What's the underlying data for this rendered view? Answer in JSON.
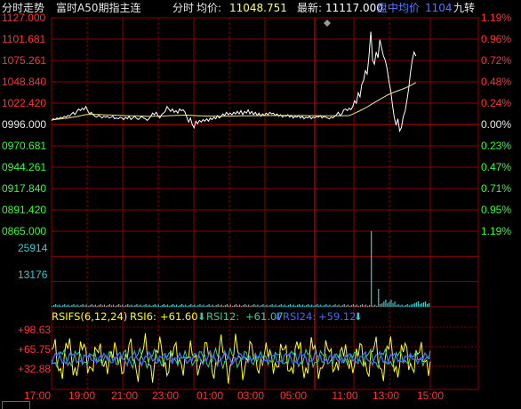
{
  "header": {
    "mode_label": "分时走势",
    "instrument": "富时A50期指主连",
    "series_label": "分时",
    "avg_label": "均价:",
    "avg_value": "11048.751",
    "last_label": "最新:",
    "last_value": "11117.000",
    "vwap_label": "盘中均价",
    "vwap_value": "1104",
    "right_label": "九转"
  },
  "indicator": {
    "name": "RSIFS(6,12,24)",
    "rsi6_label": "RSI6:",
    "rsi6_value": "+61.60",
    "rsi12_label": "RSI12:",
    "rsi12_value": "+61.07",
    "rsi24_label": "RSI24:",
    "rsi24_value": "+59.12"
  },
  "colors": {
    "background": "#000000",
    "grid": "#8b0000",
    "price_line": "#ffffff",
    "avg_line": "#f0e68c",
    "up": "#ff3333",
    "down": "#33ff33",
    "volume": "#33cccc",
    "rsi6": "#ffff00",
    "rsi12": "#33cc99",
    "rsi24": "#4466ff",
    "label_white": "#e8e8e8"
  },
  "chart_data": {
    "type": "line",
    "title": "富时A50期指主连 分时",
    "price_axis": {
      "ylim": [
        996.0,
        1127.0
      ],
      "base": 996.0,
      "ticks_left": [
        "1127.000",
        "1101.681",
        "1075.261",
        "1048.840",
        "1022.420",
        "0996.000",
        "0970.681",
        "0944.261",
        "0917.840",
        "0891.420",
        "0865.000"
      ],
      "ticks_right": [
        "1.19%",
        "0.96%",
        "0.72%",
        "0.48%",
        "0.24%",
        "0.00%",
        "0.23%",
        "0.47%",
        "0.71%",
        "0.95%",
        "1.19%"
      ]
    },
    "volume_axis": {
      "ylim": [
        0,
        38671
      ],
      "ticks": [
        "25914",
        "13176"
      ]
    },
    "rsi_axis": {
      "ylim": [
        0,
        110
      ],
      "ticks": [
        "+98.63",
        "+65.75",
        "+32.88"
      ]
    },
    "time_labels": [
      "17:00",
      "19:00",
      "21:00",
      "23:00",
      "01:00",
      "03:00",
      "05:00",
      "11:00",
      "13:00",
      "15:00"
    ],
    "price": {
      "x": [
        0,
        2,
        4,
        6,
        8,
        10,
        12,
        14,
        16,
        18,
        20,
        22,
        24,
        26,
        28,
        30,
        32,
        34,
        36,
        38,
        40,
        42,
        44,
        46,
        48,
        50,
        52,
        54,
        56,
        58,
        60,
        62,
        64,
        66,
        68,
        70,
        72,
        74,
        76,
        78,
        80,
        82,
        84,
        86,
        88,
        90,
        92,
        94,
        96,
        98,
        100,
        102,
        104,
        106,
        108,
        110,
        112,
        114,
        116,
        118,
        120,
        122,
        124,
        126,
        128,
        130,
        132,
        134,
        136,
        138,
        140,
        142,
        144,
        146,
        148,
        150,
        152,
        154,
        156,
        158,
        160,
        162,
        164,
        166,
        168,
        170,
        172,
        174,
        176,
        178,
        180,
        182,
        184,
        186,
        188,
        190,
        192,
        194,
        196,
        198,
        200,
        202,
        204,
        206,
        208,
        210,
        212,
        214,
        216,
        218,
        220,
        222,
        224,
        226,
        228,
        230,
        232,
        234,
        236,
        238,
        240,
        242,
        244,
        246,
        248,
        250,
        252,
        254,
        256,
        258,
        260,
        262,
        264,
        266,
        268,
        270,
        272,
        274,
        276,
        278,
        280,
        282,
        284,
        286,
        288,
        290,
        292,
        294,
        296,
        298,
        300,
        302,
        304,
        306,
        308,
        310,
        312,
        314,
        316,
        318,
        320,
        322,
        324,
        326,
        328,
        330,
        332,
        334,
        336,
        338,
        340,
        342,
        344,
        346,
        348,
        350,
        352,
        354,
        356,
        358,
        360,
        362,
        364,
        366,
        368,
        370,
        372,
        374,
        376,
        378,
        380,
        382,
        384,
        386,
        388,
        390,
        392,
        394,
        396,
        398,
        400,
        402,
        404,
        406,
        408,
        410,
        412,
        414,
        416,
        418,
        420
      ],
      "y": [
        1001,
        1003,
        1002,
        1004,
        1003,
        1005,
        1004,
        1006,
        1005,
        1007,
        1006,
        1009,
        1011,
        1008,
        1012,
        1015,
        1013,
        1016,
        1014,
        1018,
        1013,
        1009,
        1011,
        1008,
        1006,
        1005,
        1007,
        1006,
        1004,
        1006,
        1005,
        1006,
        1004,
        1005,
        1006,
        1003,
        1004,
        1003,
        1005,
        1004,
        1002,
        1005,
        1003,
        1006,
        1002,
        1004,
        1006,
        1004,
        1002,
        1004,
        1006,
        1004,
        1003,
        1001,
        1003,
        1006,
        1010,
        1008,
        1011,
        1007,
        1004,
        1008,
        1010,
        1012,
        1018,
        1015,
        1012,
        1015,
        1011,
        1013,
        1010,
        1015,
        1013,
        1014,
        1011,
        1005,
        999,
        1004,
        996,
        992,
        1000,
        997,
        1001,
        999,
        1002,
        1000,
        1003,
        1000,
        1004,
        1002,
        1005,
        1003,
        1007,
        1004,
        1006,
        1009,
        1007,
        1011,
        1008,
        1010,
        1008,
        1011,
        1009,
        1012,
        1009,
        1013,
        1008,
        1012,
        1010,
        1014,
        1009,
        1012,
        1008,
        1011,
        1007,
        1010,
        1006,
        1009,
        1007,
        1010,
        1008,
        1011,
        1009,
        1010,
        1007,
        1009,
        1006,
        1008,
        1005,
        1007,
        1006,
        1008,
        1005,
        1007,
        1004,
        1006,
        1005,
        1007,
        1004,
        1006,
        1003,
        1005,
        1004,
        1006,
        1003,
        1005,
        1004,
        1006,
        1005,
        1007,
        1004,
        1006,
        1005,
        1004,
        1003,
        1005,
        1004,
        1006,
        1008,
        1011,
        1007,
        1009,
        1014,
        1015,
        1013,
        1016,
        1014,
        1018,
        1025,
        1022,
        1035,
        1030,
        1045,
        1050,
        1062,
        1058,
        1080,
        1110,
        1075,
        1070,
        1085,
        1078,
        1100,
        1090,
        1080,
        1075,
        1065,
        1050,
        1038,
        1020,
        1005,
        995,
        1003,
        988,
        992,
        1006,
        1012,
        1025,
        1040,
        1060,
        1075,
        1085,
        1080
      ],
      "values": [
        1001,
        1003,
        1002,
        1004,
        1003,
        1005,
        1004,
        1006,
        1005,
        1007,
        1006,
        1009,
        1011,
        1008,
        1012,
        1015,
        1013,
        1016,
        1014,
        1018,
        1013,
        1009,
        1011,
        1008,
        1006,
        1005,
        1007,
        1006,
        1004,
        1006,
        1005,
        1006,
        1004,
        1005,
        1006,
        1003,
        1004,
        1003,
        1005,
        1004,
        1002,
        1005,
        1003,
        1006,
        1002,
        1004,
        1006,
        1004,
        1002,
        1004,
        1006,
        1004,
        1003,
        1001,
        1003,
        1006,
        1010,
        1008,
        1011,
        1007,
        1004,
        1008,
        1010,
        1012,
        1018,
        1015,
        1012,
        1015,
        1011,
        1013,
        1010,
        1015,
        1013,
        1014,
        1011,
        1005,
        999,
        1004,
        996,
        992,
        1000,
        997,
        1001,
        999,
        1002,
        1000,
        1003,
        1000,
        1004,
        1002,
        1005,
        1003,
        1007,
        1004,
        1006,
        1009,
        1007,
        1011,
        1008,
        1010,
        1008,
        1011,
        1009,
        1012,
        1009,
        1013,
        1008,
        1012,
        1010,
        1014,
        1009,
        1012,
        1008,
        1011,
        1007,
        1010,
        1006,
        1009,
        1007,
        1010,
        1008,
        1011,
        1009,
        1010,
        1007,
        1009,
        1006,
        1008,
        1005,
        1007,
        1006,
        1008,
        1005,
        1007,
        1004,
        1006,
        1005,
        1007,
        1004,
        1006,
        1003,
        1005,
        1004,
        1006,
        1003,
        1005,
        1004,
        1006,
        1005,
        1007,
        1004,
        1006,
        1005,
        1004,
        1003,
        1005,
        1004,
        1006,
        1008,
        1011,
        1007,
        1009,
        1014,
        1015,
        1013,
        1016,
        1014,
        1018,
        1025,
        1022,
        1035,
        1030,
        1045,
        1050,
        1062,
        1058,
        1080,
        1110,
        1075,
        1070,
        1085,
        1078,
        1100,
        1090,
        1080,
        1075,
        1065,
        1050,
        1038,
        1020,
        1005,
        995,
        1003,
        988,
        992,
        1006,
        1012,
        1025,
        1040,
        1060,
        1075,
        1085,
        1080
      ]
    }
  }
}
